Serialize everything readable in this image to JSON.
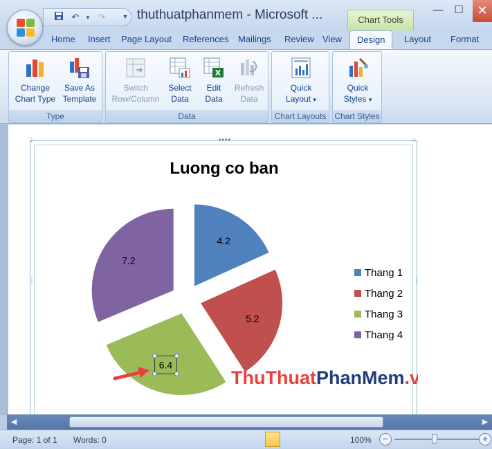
{
  "window": {
    "title": "thuthuatphanmem - Microsoft ...",
    "context_tab": "Chart Tools",
    "minimize_icon": "minimize-icon",
    "maximize_icon": "maximize-icon",
    "close_icon": "close-icon"
  },
  "tabs": [
    "Home",
    "Insert",
    "Page Layout",
    "References",
    "Mailings",
    "Review",
    "View",
    "Design",
    "Layout",
    "Format"
  ],
  "active_tab": "Design",
  "ribbon": {
    "groups": [
      {
        "label": "Type",
        "buttons": [
          {
            "line1": "Change",
            "line2": "Chart Type",
            "icon": "bar-chart-icon",
            "enabled": true
          },
          {
            "line1": "Save As",
            "line2": "Template",
            "icon": "save-template-icon",
            "enabled": true
          }
        ]
      },
      {
        "label": "Data",
        "buttons": [
          {
            "line1": "Switch",
            "line2": "Row/Column",
            "icon": "switch-row-column-icon",
            "enabled": false
          },
          {
            "line1": "Select",
            "line2": "Data",
            "icon": "select-data-icon",
            "enabled": true
          },
          {
            "line1": "Edit",
            "line2": "Data",
            "icon": "excel-sheet-icon",
            "enabled": true
          },
          {
            "line1": "Refresh",
            "line2": "Data",
            "icon": "refresh-data-icon",
            "enabled": false
          }
        ]
      },
      {
        "label": "Chart Layouts",
        "buttons": [
          {
            "line1": "Quick",
            "line2": "Layout",
            "icon": "chart-layout-icon",
            "enabled": true,
            "dropdown": "▾"
          }
        ]
      },
      {
        "label": "Chart Styles",
        "buttons": [
          {
            "line1": "Quick",
            "line2": "Styles",
            "icon": "paint-brushes-icon",
            "enabled": true,
            "dropdown": "▾"
          }
        ]
      }
    ]
  },
  "chart_data": {
    "type": "pie",
    "title": "Luong co ban",
    "exploded": true,
    "categories": [
      "Thang 1",
      "Thang 2",
      "Thang 3",
      "Thang 4"
    ],
    "values": [
      4.2,
      5.2,
      6.4,
      7.2
    ],
    "data_labels": [
      "4.2",
      "5.2",
      "6.4",
      "7.2"
    ],
    "colors": [
      "#4f81bd",
      "#c0504d",
      "#9bbb59",
      "#8064a2"
    ],
    "legend_position": "right",
    "selected_label": "6.4"
  },
  "watermark": {
    "part1": "ThuThuat",
    "part2": "PhanMem",
    "part3": ".vn"
  },
  "statusbar": {
    "page": "Page: 1 of 1",
    "words": "Words: 0",
    "zoom": "100%",
    "zoom_out": "−",
    "zoom_in": "+"
  }
}
